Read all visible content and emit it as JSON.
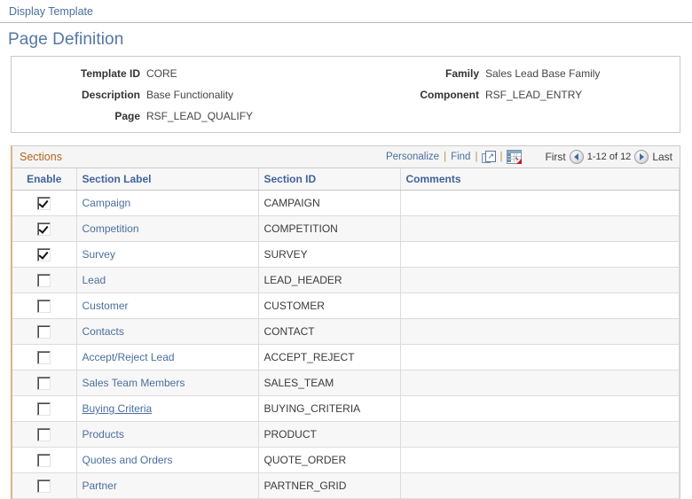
{
  "breadcrumb": {
    "label": "Display Template"
  },
  "page": {
    "title": "Page Definition"
  },
  "detail": {
    "template_id_label": "Template ID",
    "template_id_value": "CORE",
    "family_label": "Family",
    "family_value": "Sales Lead Base Family",
    "description_label": "Description",
    "description_value": "Base Functionality",
    "component_label": "Component",
    "component_value": "RSF_LEAD_ENTRY",
    "page_label": "Page",
    "page_value": "RSF_LEAD_QUALIFY"
  },
  "grid": {
    "title": "Sections",
    "personalize_label": "Personalize",
    "find_label": "Find",
    "separator": "|",
    "expand_icon": "expand-window-icon",
    "excel_icon": "download-to-excel-icon",
    "first_label": "First",
    "last_label": "Last",
    "range_label": "1-12 of 12",
    "columns": {
      "enable": "Enable",
      "section_label": "Section Label",
      "section_id": "Section ID",
      "comments": "Comments"
    },
    "rows": [
      {
        "enabled": true,
        "label": "Campaign",
        "id": "CAMPAIGN",
        "comments": "",
        "focused": false
      },
      {
        "enabled": true,
        "label": "Competition",
        "id": "COMPETITION",
        "comments": "",
        "focused": false
      },
      {
        "enabled": true,
        "label": "Survey",
        "id": "SURVEY",
        "comments": "",
        "focused": false
      },
      {
        "enabled": false,
        "label": "Lead",
        "id": "LEAD_HEADER",
        "comments": "",
        "focused": false
      },
      {
        "enabled": false,
        "label": "Customer",
        "id": "CUSTOMER",
        "comments": "",
        "focused": false
      },
      {
        "enabled": false,
        "label": "Contacts",
        "id": "CONTACT",
        "comments": "",
        "focused": false
      },
      {
        "enabled": false,
        "label": "Accept/Reject Lead",
        "id": "ACCEPT_REJECT",
        "comments": "",
        "focused": false
      },
      {
        "enabled": false,
        "label": "Sales Team Members",
        "id": "SALES_TEAM",
        "comments": "",
        "focused": false
      },
      {
        "enabled": false,
        "label": "Buying Criteria",
        "id": "BUYING_CRITERIA",
        "comments": "",
        "focused": true
      },
      {
        "enabled": false,
        "label": "Products",
        "id": "PRODUCT",
        "comments": "",
        "focused": false
      },
      {
        "enabled": false,
        "label": "Quotes and Orders",
        "id": "QUOTE_ORDER",
        "comments": "",
        "focused": false
      },
      {
        "enabled": false,
        "label": "Partner",
        "id": "PARTNER_GRID",
        "comments": "",
        "focused": false
      }
    ]
  },
  "colors": {
    "link": "#4a6f9e",
    "title": "#5577a5",
    "grid_title": "#b5651d",
    "header_text": "#3f6498",
    "accent_border": "#d9b48a"
  }
}
